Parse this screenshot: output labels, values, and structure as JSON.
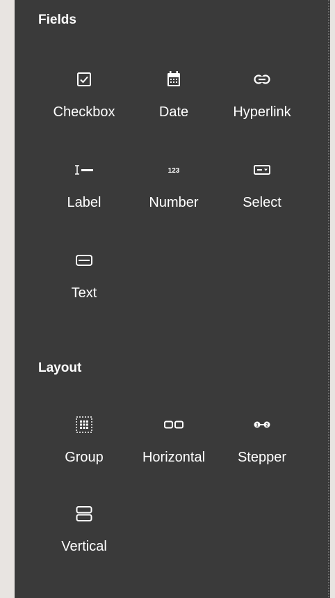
{
  "sections": {
    "fields": {
      "title": "Fields",
      "items": [
        {
          "label": "Checkbox",
          "icon": "checkbox-icon"
        },
        {
          "label": "Date",
          "icon": "calendar-icon"
        },
        {
          "label": "Hyperlink",
          "icon": "link-icon"
        },
        {
          "label": "Label",
          "icon": "text-cursor-icon"
        },
        {
          "label": "Number",
          "icon": "number-123-icon"
        },
        {
          "label": "Select",
          "icon": "select-dropdown-icon"
        },
        {
          "label": "Text",
          "icon": "text-input-icon"
        }
      ]
    },
    "layout": {
      "title": "Layout",
      "items": [
        {
          "label": "Group",
          "icon": "group-grid-icon"
        },
        {
          "label": "Horizontal",
          "icon": "horizontal-layout-icon"
        },
        {
          "label": "Stepper",
          "icon": "stepper-icon"
        },
        {
          "label": "Vertical",
          "icon": "vertical-layout-icon"
        }
      ]
    }
  },
  "colors": {
    "panel_bg": "#3a3a3a",
    "page_bg": "#e8e4e1",
    "text": "#ffffff"
  }
}
